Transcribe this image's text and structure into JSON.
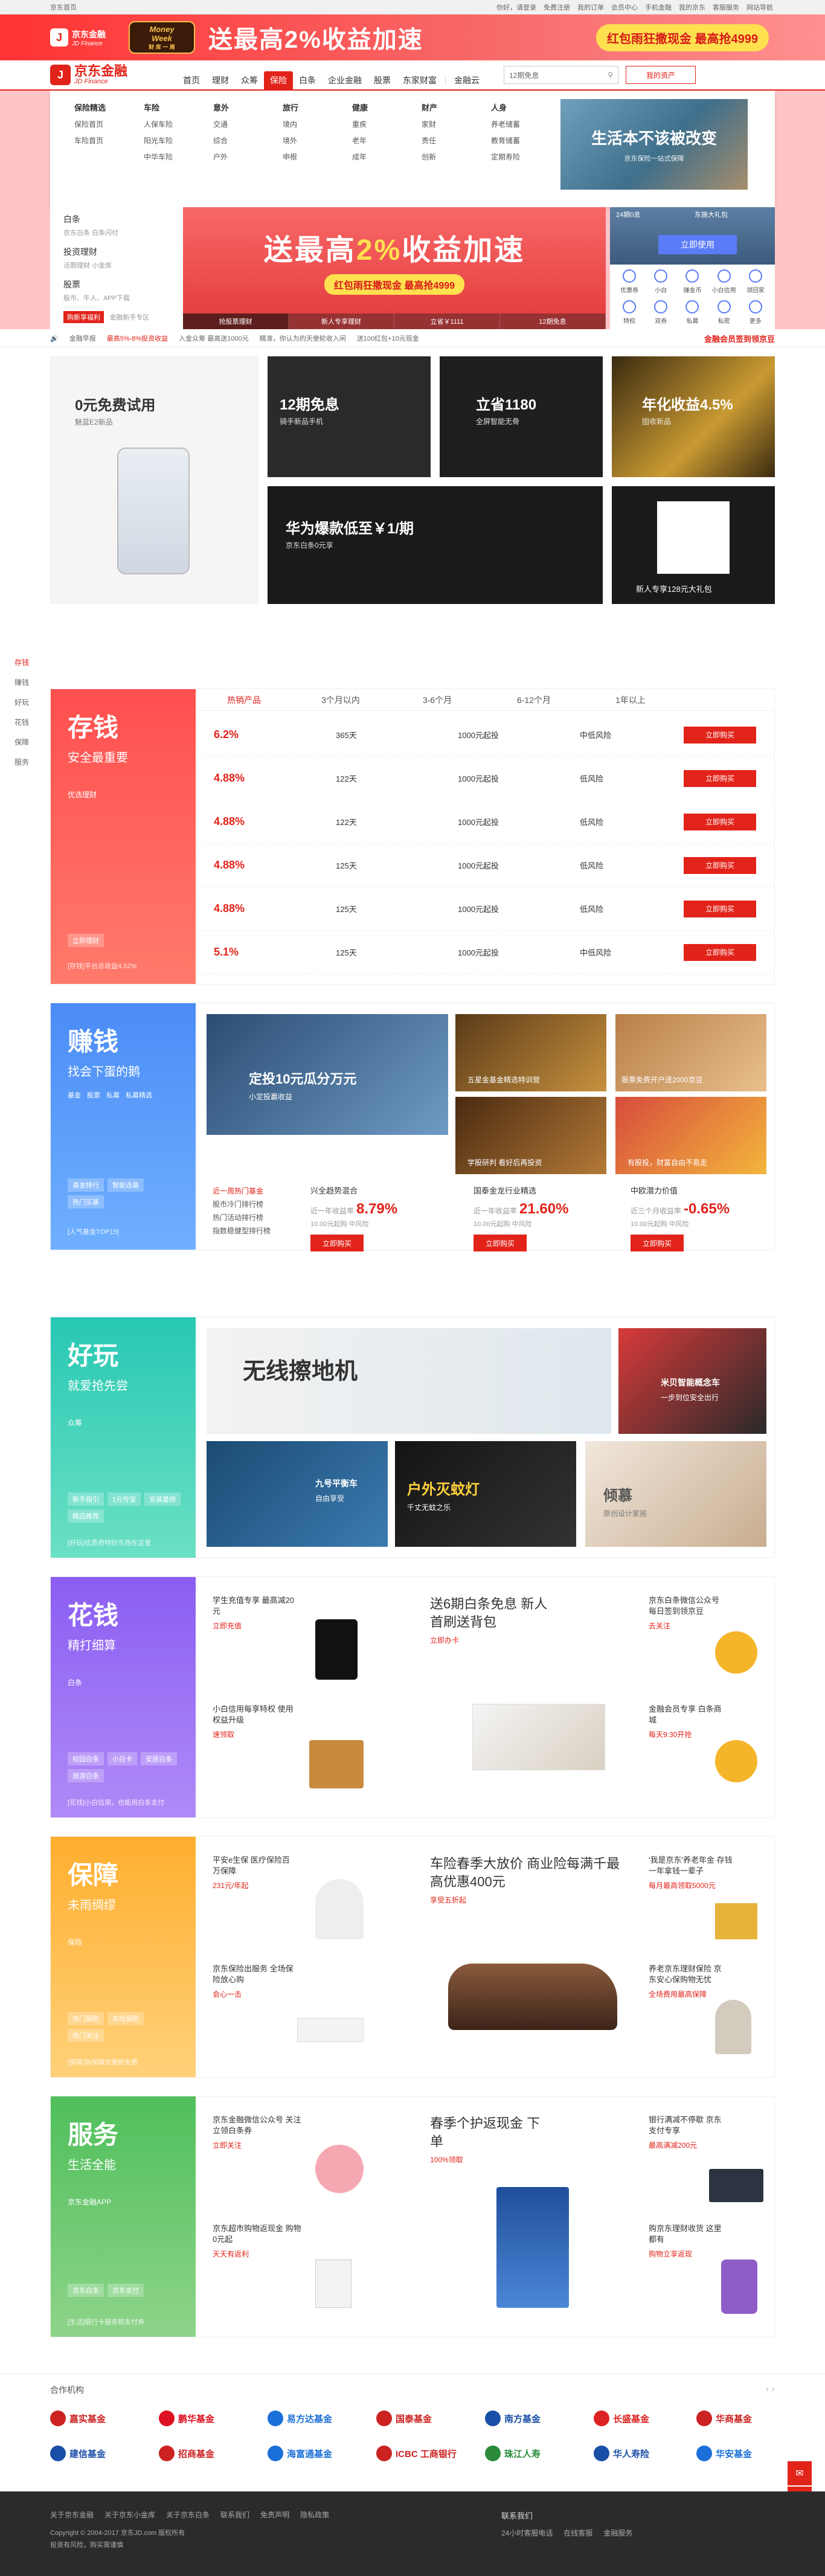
{
  "topbar": {
    "home": "京东首页",
    "links": [
      "你好，请登录",
      "免费注册",
      "我的订单",
      "会员中心",
      "手机金融",
      "我的京东",
      "客服服务",
      "网站导航"
    ]
  },
  "promo": {
    "logo_cn": "京东金融",
    "logo_en": "JD Finance",
    "badge_top": "Money",
    "badge_mid": "Week",
    "badge_bottom": "财 库 一 周",
    "title": "送最高2%收益加速",
    "pill": "红包雨狂撒现金 最高抢4999"
  },
  "header": {
    "brand_cn": "京东金融",
    "brand_en": "JD Finance",
    "nav": [
      "首页",
      "理财",
      "众筹",
      "保险",
      "白条",
      "企业金融",
      "股票",
      "东家财富"
    ],
    "nav_extra": "金融云",
    "search_placeholder": "12期免息",
    "my_assets": "我的资产"
  },
  "mega": {
    "cols": [
      {
        "h": "保险精选",
        "r": [
          [
            "保险首页"
          ],
          [
            "车险首页"
          ]
        ]
      },
      {
        "h": "车险",
        "r": [
          [
            "人保车险"
          ],
          [
            "阳光车险"
          ],
          [
            "中华车险"
          ]
        ]
      },
      {
        "h": "意外",
        "r": [
          [
            "交通"
          ],
          [
            "综合"
          ],
          [
            "户外"
          ]
        ]
      },
      {
        "h": "旅行",
        "r": [
          [
            "境内"
          ],
          [
            "境外"
          ],
          [
            "申根"
          ]
        ]
      },
      {
        "h": "健康",
        "r": [
          [
            "重疾"
          ],
          [
            "老年"
          ],
          [
            "成年"
          ]
        ]
      },
      {
        "h": "财产",
        "r": [
          [
            "家财"
          ],
          [
            "责任"
          ],
          [
            "创新"
          ]
        ]
      },
      {
        "h": "人身",
        "r": [
          [
            "养老储蓄"
          ],
          [
            "教育储蓄"
          ],
          [
            "定期寿险"
          ]
        ]
      }
    ],
    "ad_title": "生活本不该被改变",
    "ad_sub": "京东保险一站式保障"
  },
  "leftcat": [
    {
      "h": "白条",
      "d": "京东白条 白条闪付"
    },
    {
      "h": "投资理财",
      "d": "活期理财 小金库"
    },
    {
      "h": "股票",
      "d": "股市、牛人、APP下载"
    }
  ],
  "leftcat_badge": "购新享福利",
  "leftcat_badge2": "金融新手专区",
  "herobanner": {
    "t1": "送最高",
    "t2": "2%",
    "t3": "收益加速",
    "pill": "红包雨狂撒现金 最高抢4999",
    "tabs": [
      "抢股票理财",
      "新人专享理财",
      "立省￥1111",
      "12期免息"
    ]
  },
  "rightbox": {
    "labels": [
      "24期0息",
      "东施大礼包"
    ],
    "btn": "立即使用",
    "icons": [
      "优惠券",
      "小白",
      "赚金币",
      "小白信用",
      "领回家",
      "特权",
      "双券",
      "私募",
      "私密",
      "更多"
    ]
  },
  "ticker": {
    "label": "金融早报",
    "items": [
      "最高5%-8%投资收益",
      "入金众筹 最高送1000元",
      "精准，你认为的天使轮收入闲",
      "送100红包+10元现金"
    ],
    "right": "金融会员签到领京豆"
  },
  "tiles": [
    {
      "t": "0元免费试用",
      "s": "魅蓝E2新品"
    },
    {
      "t": "12期免息",
      "s": "骑手新品手机"
    },
    {
      "t": "立省1180",
      "s": "全屏智能无骨"
    },
    {
      "t": "年化收益4.5%",
      "s": "固收新品"
    },
    {
      "t": "华为爆款低至￥1/期",
      "s": "京东白条0元享"
    },
    {
      "t": "新人专享128元大礼包",
      "s": "扫码下载APP"
    }
  ],
  "sidenav": [
    "存钱",
    "赚钱",
    "好玩",
    "花钱",
    "保障",
    "服务"
  ],
  "cunqian": {
    "h": "存钱",
    "s": "安全最重要",
    "tags": [
      "优选理财"
    ],
    "btn": "立即理财",
    "tip": "[存钱]平台总收益4.52%",
    "tabs": [
      "热销产品",
      "3个月以内",
      "3-6个月",
      "6-12个月",
      "1年以上"
    ],
    "rows": [
      {
        "rate": "6.2%",
        "days": "365天",
        "amt": "1000元起投",
        "note": "中低风险"
      },
      {
        "rate": "4.88%",
        "days": "122天",
        "amt": "1000元起投",
        "note": "低风险"
      },
      {
        "rate": "4.88%",
        "days": "122天",
        "amt": "1000元起投",
        "note": "低风险"
      },
      {
        "rate": "4.88%",
        "days": "125天",
        "amt": "1000元起投",
        "note": "低风险"
      },
      {
        "rate": "4.88%",
        "days": "125天",
        "amt": "1000元起投",
        "note": "低风险"
      },
      {
        "rate": "5.1%",
        "days": "125天",
        "amt": "1000元起投",
        "note": "中低风险"
      }
    ],
    "buy": "立即购买"
  },
  "zhuanqian": {
    "h": "赚钱",
    "s": "找会下蛋的鹅",
    "tags": [
      "基金",
      "股票",
      "私募",
      "私募精选"
    ],
    "tags2": [
      "基金排行",
      "智能选基",
      "热门买基"
    ],
    "tip": "[人气基金TOP15]",
    "cards": [
      {
        "t": "定投10元瓜分万元",
        "s": "小定投赢收益"
      },
      {
        "t": "五星金基金精选特训营",
        "s": ""
      },
      {
        "t": "股票免费开户送2000京豆",
        "s": ""
      },
      {
        "t": "学股研判 看好后再投资",
        "s": ""
      },
      {
        "t": "有股投，财富自由不易走",
        "s": ""
      }
    ],
    "side": [
      "近一周热门基金",
      "股市冷门排行榜",
      "热门活动排行榜",
      "指数稳健型排行榜"
    ],
    "funds": [
      {
        "n": "兴全趋势混合",
        "y": "近一年收益率",
        "v": "8.79%",
        "r": "10.00元起购 中风险"
      },
      {
        "n": "国泰金龙行业精选",
        "y": "近一年收益率",
        "v": "21.60%",
        "r": "10.00元起购 中风险"
      },
      {
        "n": "中欧潜力价值",
        "y": "近三个月收益率",
        "v": "-0.65%",
        "r": "10.00元起购 中风险"
      }
    ],
    "buy": "立即购买"
  },
  "haowan": {
    "h": "好玩",
    "s": "就爱抢先尝",
    "tags": [
      "众筹"
    ],
    "tags2": [
      "新手指引",
      "1元夺宝",
      "安装量榜",
      "精品推荐"
    ],
    "tip": "[好玩]优质奇特好东西在这里",
    "cards": [
      {
        "t": "无线擦地机",
        "s": ""
      },
      {
        "t": "米贝智能概念车",
        "s": "一步到位安全出行"
      },
      {
        "t": "九号平衡车",
        "s": "自由享受"
      },
      {
        "t": "户外灭蚊灯",
        "s": "千丈无蚊之乐"
      },
      {
        "t": "倾慕",
        "s": "原创设计家居"
      }
    ]
  },
  "huaqian": {
    "h": "花钱",
    "s": "精打细算",
    "tags": [
      "白条"
    ],
    "tags2": [
      "校园白条",
      "小白卡",
      "安居白条",
      "旅游白条"
    ],
    "tip": "[花钱]小白信用，也能用白条支付",
    "items": [
      {
        "t": "学生充值专享 最高减20元",
        "l": "立即充值"
      },
      {
        "t": "送6期白条免息 新人首刷送背包",
        "l": "立即办卡"
      },
      {
        "t": "京东白条微信公众号 每日签到领京豆",
        "l": "去关注"
      },
      {
        "t": "小白信用每享特权 使用权益升级",
        "l": "速领取"
      },
      {
        "t": "金融会员专享 白条商城",
        "l": "每天9:30开抢"
      }
    ]
  },
  "baozhang": {
    "h": "保障",
    "s": "未雨绸缪",
    "tags": [
      "保险"
    ],
    "tags2": [
      "热门保险",
      "车险保险",
      "热门关注"
    ],
    "tip": "[保障]购保障优惠和免费",
    "items": [
      {
        "t": "平安e生保 医疗保险百万保障",
        "l": "231元/年起"
      },
      {
        "t": "车险春季大放价 商业险每满千最高优惠400元",
        "l": "享受五折起"
      },
      {
        "t": "'我是京东'养老年金 存钱一年拿钱一辈子",
        "l": "每月最高领取5000元"
      },
      {
        "t": "京东保险出服务 全场保险放心购",
        "l": "会心一击"
      },
      {
        "t": "养老京东理财保险 京东安心保购物无忧",
        "l": "全场费用最高保障"
      }
    ]
  },
  "fuwu": {
    "h": "服务",
    "s": "生活全能",
    "tags": [
      "京东金融APP"
    ],
    "tags2": [
      "京东白条",
      "京东支付"
    ],
    "tip": "[生活]银行卡服务和支付券",
    "items": [
      {
        "t": "京东金融微信公众号 关注立领白条券",
        "l": "立即关注"
      },
      {
        "t": "春季个护返现金 下单",
        "l": "100%领取"
      },
      {
        "t": "银行满减不停歇 京东支付专享",
        "l": "最高满减200元"
      },
      {
        "t": "京东超市购物返现金 购物0元起",
        "l": "天天有返利"
      },
      {
        "t": "购京东理财收货 这里都有",
        "l": "购物立享返现"
      }
    ]
  },
  "partners": {
    "h": "合作机构",
    "list": [
      "嘉实基金",
      "鹏华基金",
      "易方达基金",
      "国泰基金",
      "南方基金",
      "长盛基金",
      "华商基金",
      "建信基金",
      "招商基金",
      "海富通基金",
      "ICBC 工商银行",
      "珠江人寿",
      "华人寿险",
      "华安基金"
    ]
  },
  "footer": {
    "links": [
      "关于京东金融",
      "关于京东小金库",
      "关于京东白条",
      "联系我们",
      "免责声明",
      "隐私政策"
    ],
    "copy": "Copyright © 2004-2017 京东JD.com 版权所有",
    "copy2": "投资有风险，购买需谨慎",
    "contact_h": "联系我们",
    "contact": [
      "24小时客服电话",
      "在线客服",
      "金融服务"
    ]
  },
  "colors": {
    "red": "#e2231a",
    "cunqian": "#ff4a4a",
    "zhuanqian": "#4b8cf6",
    "haowan": "#30cfc0",
    "huaqian": "#8b6cf2",
    "baozhang": "#ffb43e",
    "fuwu": "#5bc56a"
  }
}
